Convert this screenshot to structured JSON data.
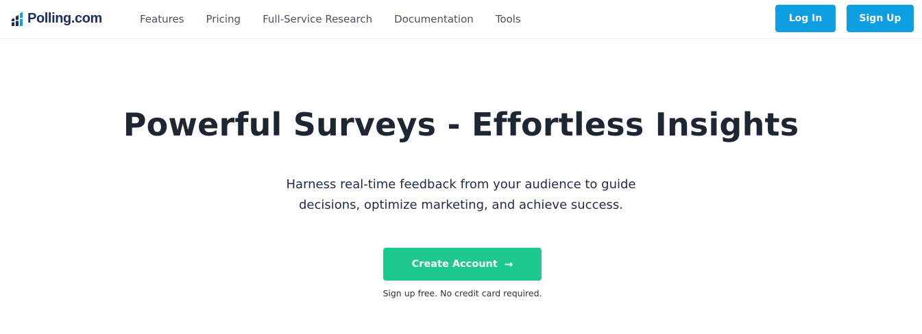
{
  "brand": {
    "name": "Polling.com",
    "logo_icon": "bar-chart-icon",
    "colors": {
      "navy": "#1b2e63",
      "blue": "#0e9fe2"
    }
  },
  "nav": {
    "items": [
      {
        "label": "Features"
      },
      {
        "label": "Pricing"
      },
      {
        "label": "Full-Service Research"
      },
      {
        "label": "Documentation"
      },
      {
        "label": "Tools"
      }
    ],
    "login_label": "Log In",
    "signup_label": "Sign Up",
    "button_color": "#0e9fe2"
  },
  "hero": {
    "title": "Powerful Surveys - Effortless Insights",
    "subtitle": "Harness real-time feedback from your audience to guide decisions, optimize marketing, and achieve success.",
    "cta_label": "Create Account",
    "cta_icon": "arrow-right-icon",
    "cta_color": "#1ec990",
    "note": "Sign up free. No credit card required."
  }
}
